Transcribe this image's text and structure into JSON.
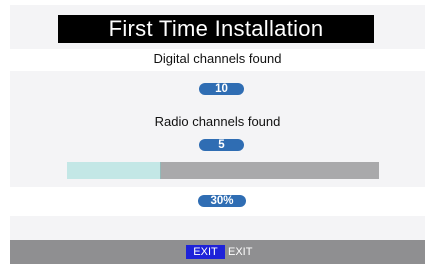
{
  "dialog": {
    "title": "First Time Installation",
    "digital_label": "Digital channels found",
    "digital_count": "10",
    "radio_label": "Radio channels found",
    "radio_count": "5",
    "progress_percent_text": "30%",
    "progress_fraction": 0.3
  },
  "footer": {
    "exit_key_label": "EXIT",
    "exit_label": "EXIT"
  },
  "colors": {
    "title_bg": "#000000",
    "pill_blue": "#2f6db3",
    "progress_fill": "#c3e7e6",
    "progress_track": "#a9a9ab",
    "footer_bg": "#8f8f91",
    "exit_key_bg": "#1e22d9"
  }
}
